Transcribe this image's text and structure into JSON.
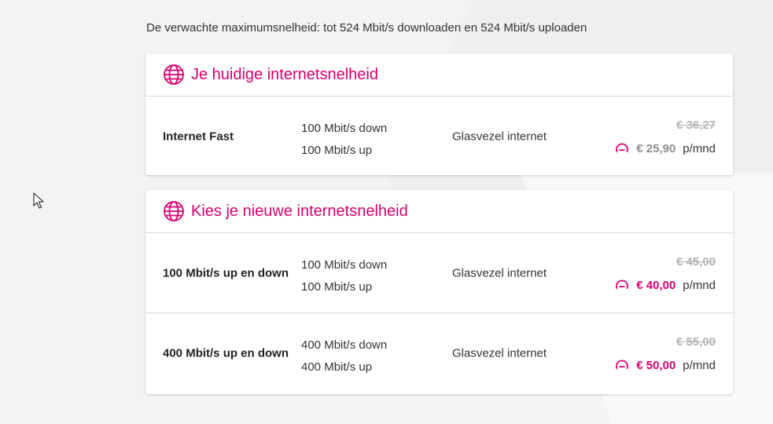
{
  "intro_text": "De verwachte maximumsnelheid: tot 524 Mbit/s downloaden en 524 Mbit/s uploaden",
  "current": {
    "title": "Je huidige internetsnelheid",
    "row": {
      "name": "Internet Fast",
      "down": "100 Mbit/s down",
      "up": "100 Mbit/s up",
      "type": "Glasvezel internet",
      "old_price": "€ 36,27",
      "price": "€ 25,90",
      "per": "p/mnd"
    }
  },
  "new": {
    "title": "Kies je nieuwe internetsnelheid",
    "rows": [
      {
        "name": "100 Mbit/s up en down",
        "down": "100 Mbit/s down",
        "up": "100 Mbit/s up",
        "type": "Glasvezel internet",
        "old_price": "€ 45,00",
        "price": "€ 40,00",
        "per": "p/mnd"
      },
      {
        "name": "400 Mbit/s up en down",
        "down": "400 Mbit/s down",
        "up": "400 Mbit/s up",
        "type": "Glasvezel internet",
        "old_price": "€ 55,00",
        "price": "€ 50,00",
        "per": "p/mnd"
      }
    ]
  },
  "colors": {
    "accent": "#d5006f",
    "muted": "#8c8c8c"
  },
  "icons": {
    "header": "globe-icon",
    "price": "speedometer-icon",
    "pointer": "mouse-cursor-icon"
  }
}
